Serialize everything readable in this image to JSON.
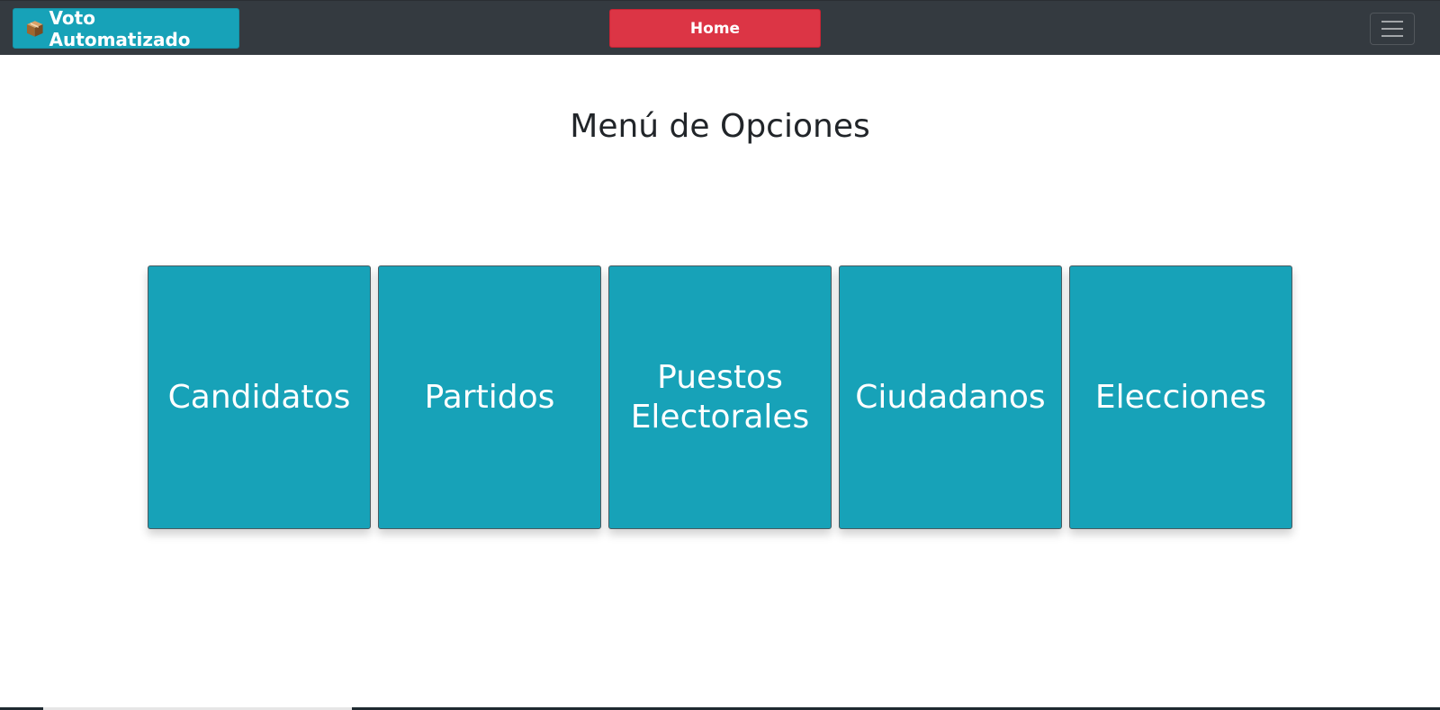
{
  "navbar": {
    "brand_label": "Voto Automatizado",
    "brand_icon": "package-icon",
    "home_label": "Home",
    "toggler_icon": "hamburger-menu-icon"
  },
  "colors": {
    "navbar_bg": "#343a40",
    "brand_bg": "#17a2b8",
    "home_bg": "#dc3545",
    "card_bg": "#17a2b8"
  },
  "main": {
    "title": "Menú de Opciones",
    "cards": [
      {
        "label": "Candidatos"
      },
      {
        "label": "Partidos"
      },
      {
        "label": "Puestos Electorales"
      },
      {
        "label": "Ciudadanos"
      },
      {
        "label": "Elecciones"
      }
    ]
  }
}
